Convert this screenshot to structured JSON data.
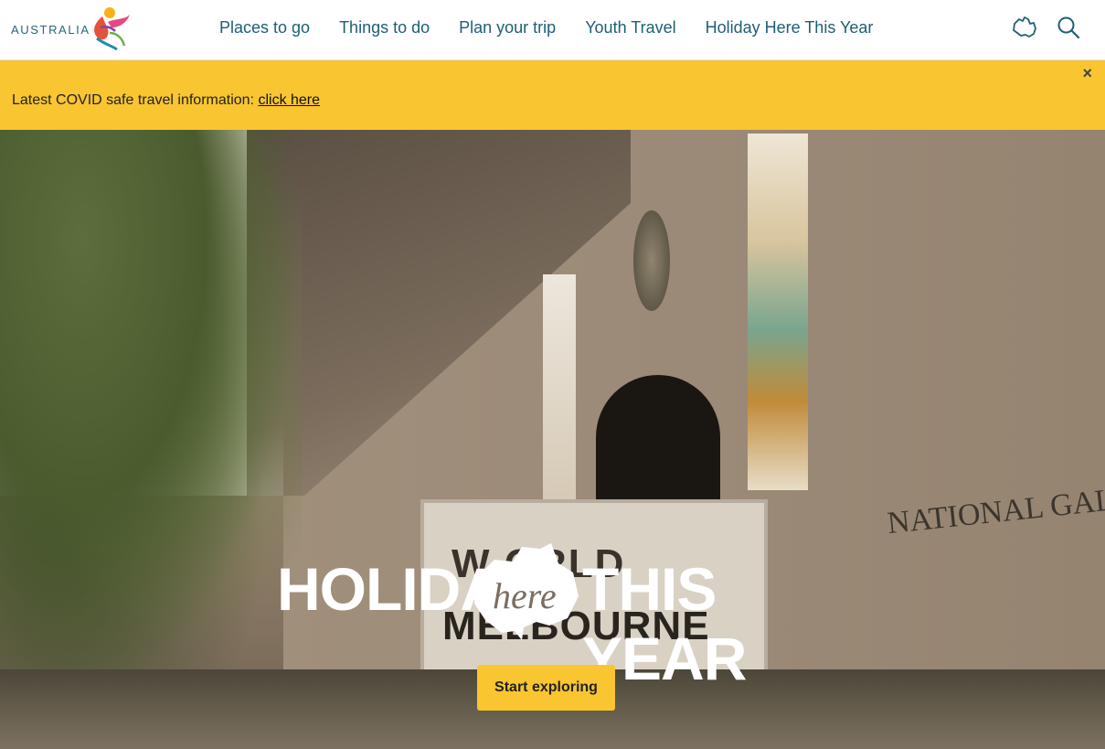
{
  "brand": {
    "name": "AUSTRALIA"
  },
  "nav": {
    "items": [
      {
        "label": "Places to go"
      },
      {
        "label": "Things to do"
      },
      {
        "label": "Plan your trip"
      },
      {
        "label": "Youth Travel"
      },
      {
        "label": "Holiday Here This Year"
      }
    ],
    "map_icon": "australia-map-icon",
    "search_icon": "search-icon"
  },
  "alert": {
    "text": "Latest COVID safe travel information: ",
    "link": "click here",
    "close": "×"
  },
  "hero": {
    "title_left": "HOLIDAY",
    "title_mid": "here",
    "title_right": "THIS YEAR",
    "sign_text_top": "W   ORLD",
    "sign_text_bottom": "MELBOURNE",
    "wall_text": "NATIONAL GALLERY OF",
    "cta": "Start exploring"
  },
  "colors": {
    "accent": "#f9c530",
    "nav_text": "#1d5f73"
  }
}
